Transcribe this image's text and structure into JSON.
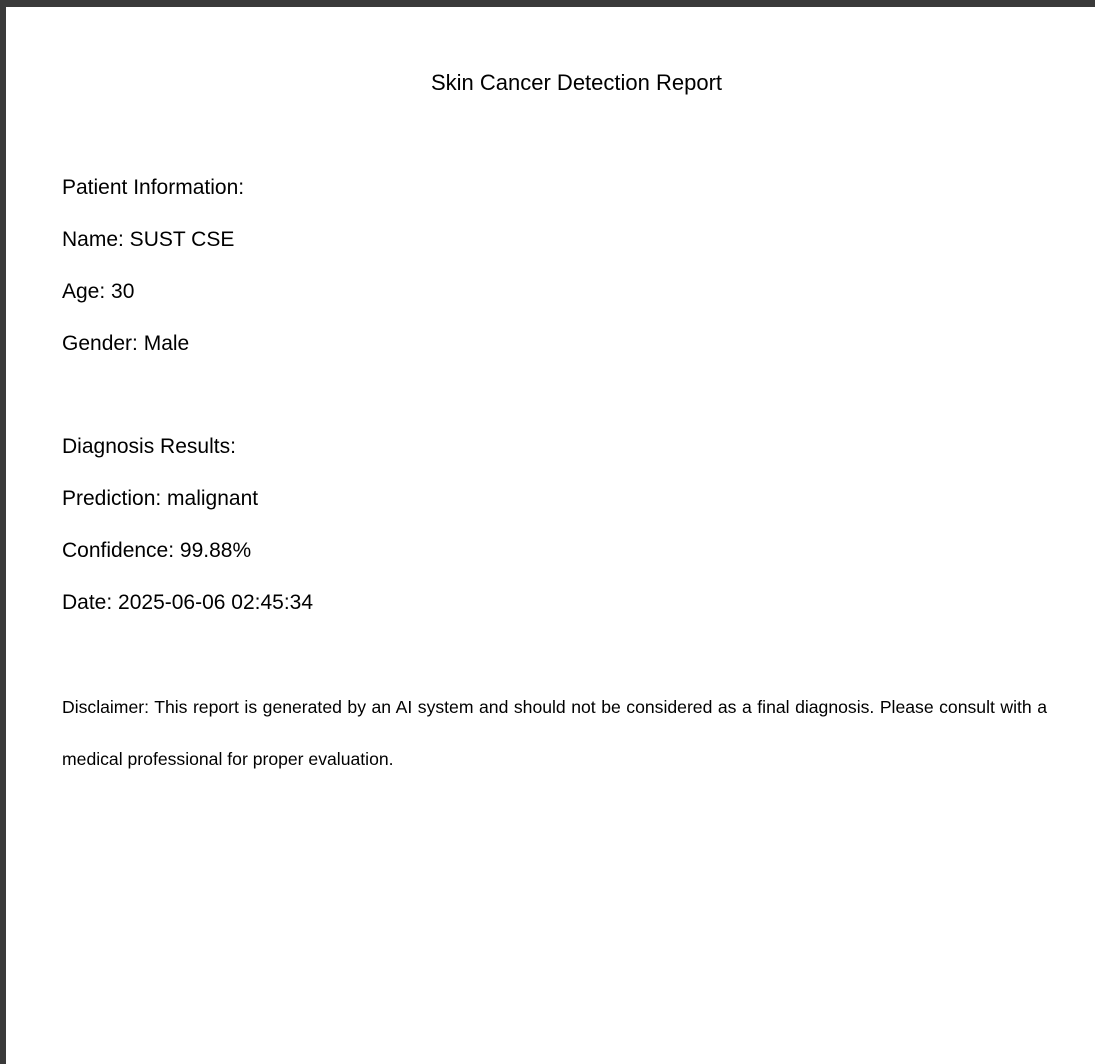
{
  "report": {
    "title": "Skin Cancer Detection Report",
    "patient_heading": "Patient Information:",
    "patient_name": "Name: SUST CSE",
    "patient_age": "Age: 30",
    "patient_gender": "Gender: Male",
    "diagnosis_heading": "Diagnosis Results:",
    "prediction": "Prediction: malignant",
    "confidence": "Confidence: 99.88%",
    "date": "Date: 2025-06-06 02:45:34",
    "disclaimer": "Disclaimer: This report is generated by an AI system and should not be considered as a final diagnosis. Please consult with a medical professional for proper evaluation."
  }
}
